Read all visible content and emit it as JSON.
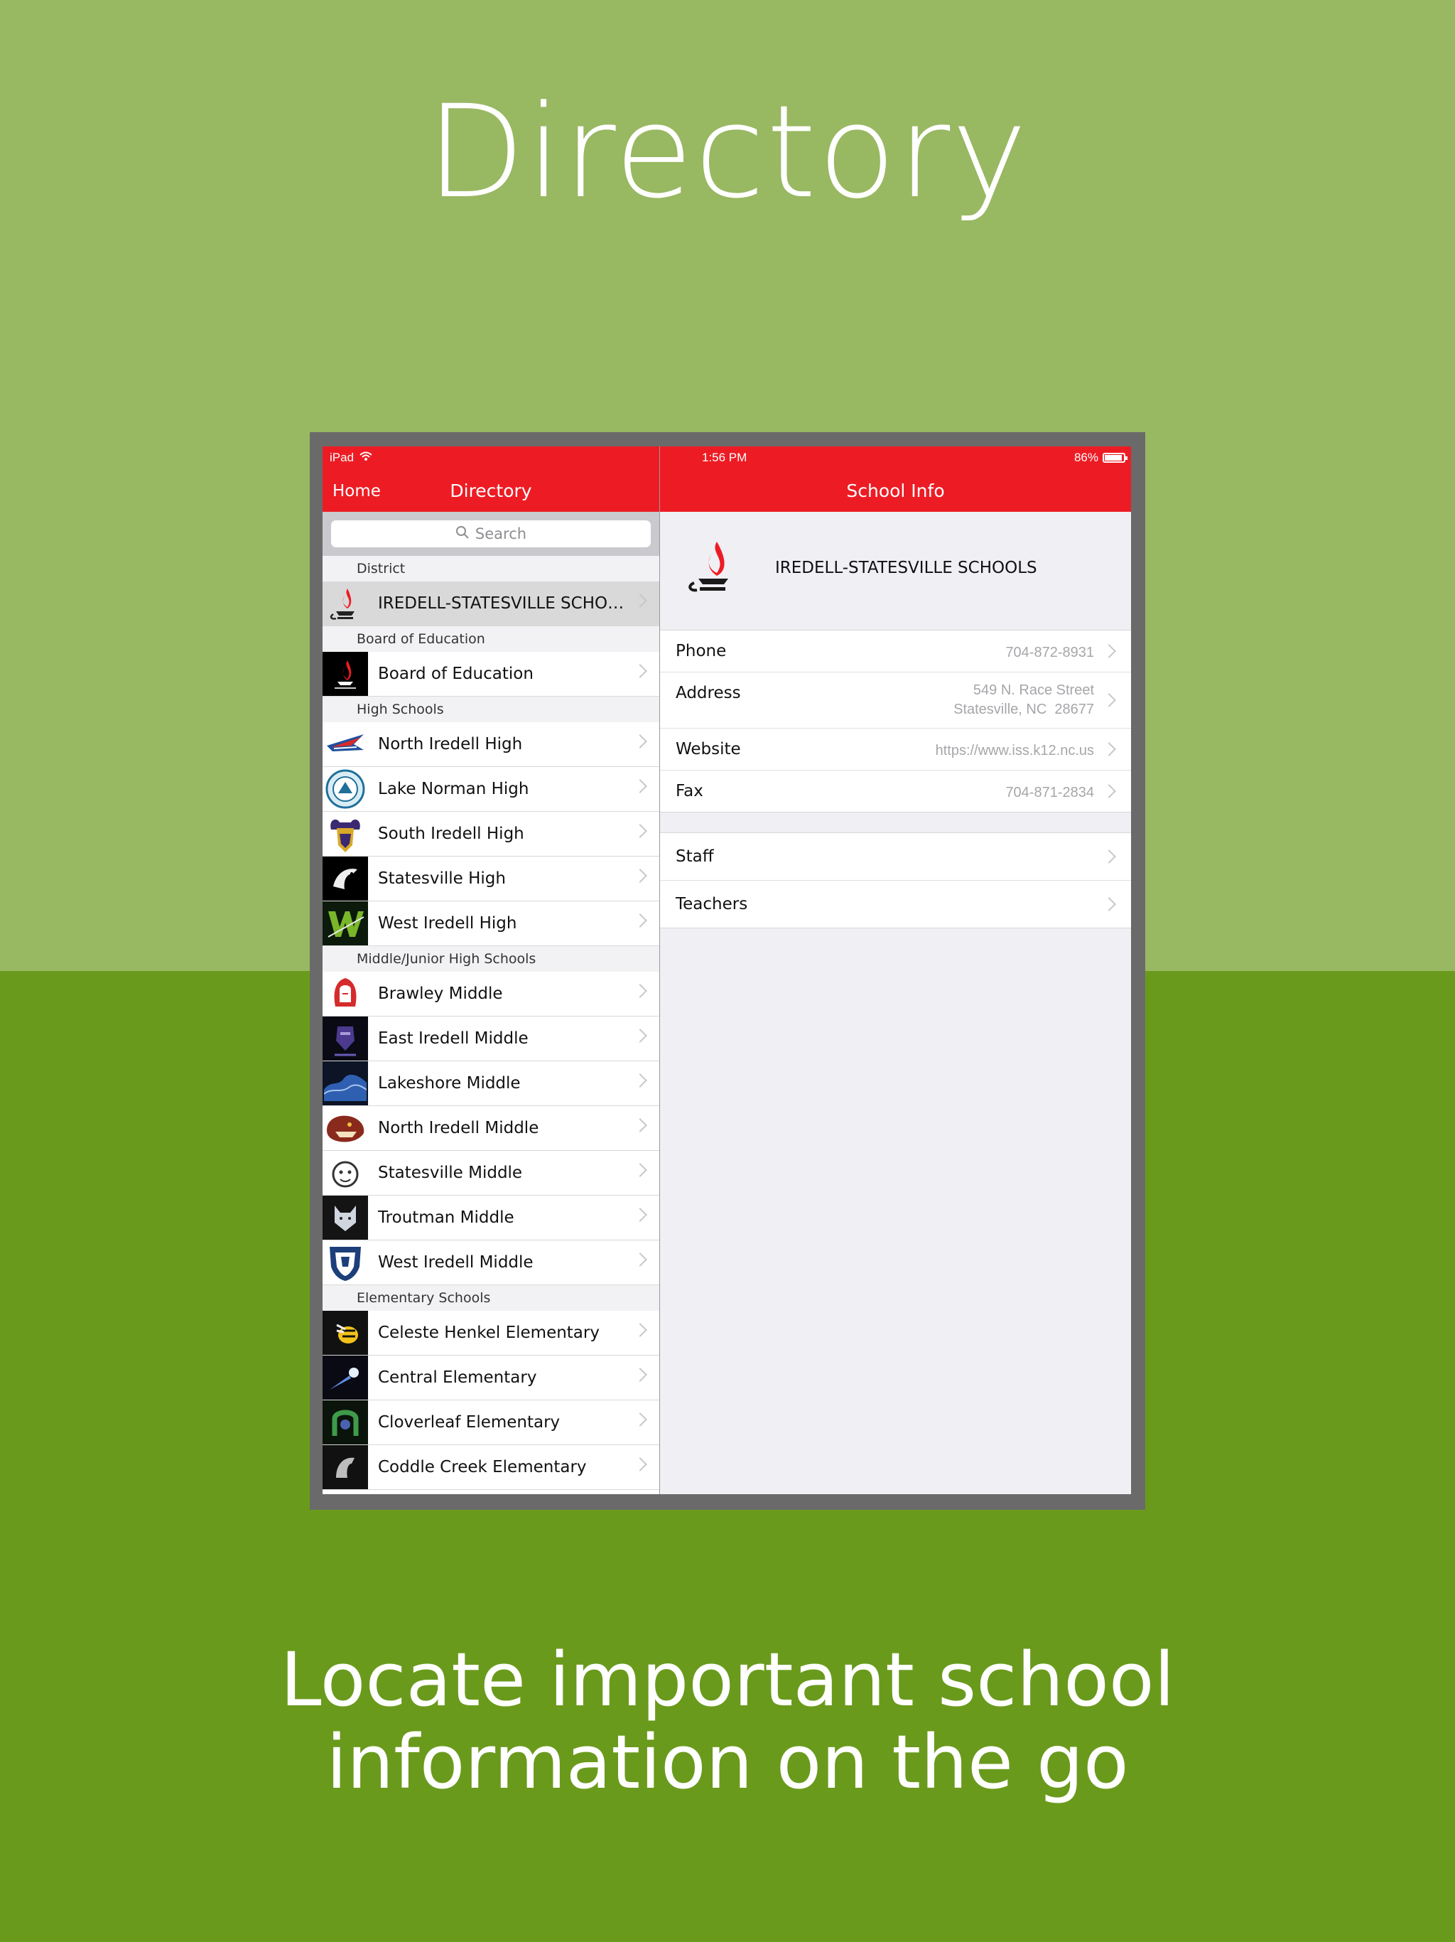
{
  "promo": {
    "title": "Directory",
    "tagline_line1": "Locate important school",
    "tagline_line2": "information on the go"
  },
  "status_bar": {
    "device": "iPad",
    "time": "1:56 PM",
    "battery": "86%"
  },
  "nav": {
    "home_label": "Home",
    "left_title": "Directory",
    "right_title": "School Info"
  },
  "search": {
    "placeholder": "Search"
  },
  "sections": [
    {
      "header": "District",
      "items": [
        {
          "label": "IREDELL-STATESVILLE SCHOOLS",
          "logo": "flame-lamp-icon"
        }
      ]
    },
    {
      "header": "Board of Education",
      "items": [
        {
          "label": "Board of Education",
          "logo": "flame-lamp-icon"
        }
      ]
    },
    {
      "header": "High Schools",
      "items": [
        {
          "label": "North Iredell High",
          "logo": "raider-icon"
        },
        {
          "label": "Lake Norman High",
          "logo": "wildcat-icon"
        },
        {
          "label": "South Iredell High",
          "logo": "viking-icon"
        },
        {
          "label": "Statesville High",
          "logo": "greyhound-icon"
        },
        {
          "label": "West Iredell High",
          "logo": "warrior-icon"
        }
      ]
    },
    {
      "header": "Middle/Junior High Schools",
      "items": [
        {
          "label": "Brawley Middle",
          "logo": "indian-head-icon"
        },
        {
          "label": "East Iredell Middle",
          "logo": "knight-icon"
        },
        {
          "label": "Lakeshore Middle",
          "logo": "wave-icon"
        },
        {
          "label": "North Iredell Middle",
          "logo": "bear-icon"
        },
        {
          "label": "Statesville Middle",
          "logo": "bulldog-icon"
        },
        {
          "label": "Troutman Middle",
          "logo": "wolf-icon"
        },
        {
          "label": "West Iredell Middle",
          "logo": "shield-icon"
        }
      ]
    },
    {
      "header": "Elementary Schools",
      "items": [
        {
          "label": "Celeste Henkel Elementary",
          "logo": "hornet-icon"
        },
        {
          "label": "Central Elementary",
          "logo": "comet-icon"
        },
        {
          "label": "Cloverleaf Elementary",
          "logo": "horseshoe-icon"
        },
        {
          "label": "Coddle Creek Elementary",
          "logo": "mustang-icon"
        }
      ]
    }
  ],
  "school_info": {
    "name": "IREDELL-STATESVILLE SCHOOLS",
    "phone_label": "Phone",
    "phone_value": "704-872-8931",
    "address_label": "Address",
    "address_line1": "549 N. Race Street",
    "address_line2": "Statesville, NC  28677",
    "website_label": "Website",
    "website_value": "https://www.iss.k12.nc.us",
    "fax_label": "Fax",
    "fax_value": "704-871-2834",
    "staff_label": "Staff",
    "teachers_label": "Teachers"
  },
  "colors": {
    "accent": "#ed1c24",
    "top_bg": "#98b862",
    "bottom_bg": "#6a9a1c"
  }
}
